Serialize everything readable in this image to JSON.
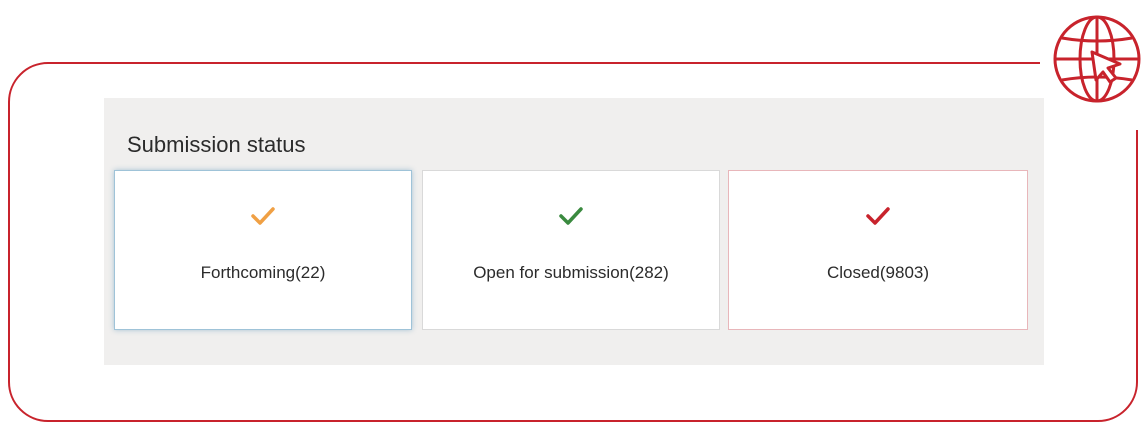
{
  "panel": {
    "title": "Submission status"
  },
  "cards": [
    {
      "label": "Forthcoming(22)",
      "color": "#f0a044"
    },
    {
      "label": "Open for submission(282)",
      "color": "#3a8a3f"
    },
    {
      "label": "Closed(9803)",
      "color": "#c8232c"
    }
  ],
  "icons": {
    "globe": "globe-cursor-icon",
    "check": "checkmark-icon"
  },
  "colors": {
    "frame": "#c8232c",
    "panel_bg": "#f0efee"
  }
}
